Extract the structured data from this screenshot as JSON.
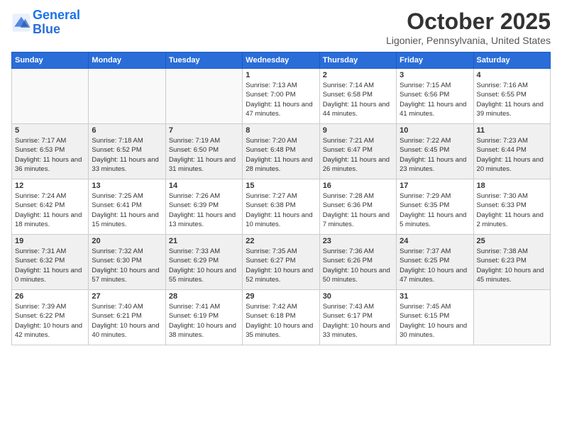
{
  "header": {
    "logo_line1": "General",
    "logo_line2": "Blue",
    "month": "October 2025",
    "location": "Ligonier, Pennsylvania, United States"
  },
  "days_of_week": [
    "Sunday",
    "Monday",
    "Tuesday",
    "Wednesday",
    "Thursday",
    "Friday",
    "Saturday"
  ],
  "weeks": [
    [
      {
        "day": "",
        "empty": true
      },
      {
        "day": "",
        "empty": true
      },
      {
        "day": "",
        "empty": true
      },
      {
        "day": "1",
        "sunrise": "7:13 AM",
        "sunset": "7:00 PM",
        "daylight": "11 hours and 47 minutes."
      },
      {
        "day": "2",
        "sunrise": "7:14 AM",
        "sunset": "6:58 PM",
        "daylight": "11 hours and 44 minutes."
      },
      {
        "day": "3",
        "sunrise": "7:15 AM",
        "sunset": "6:56 PM",
        "daylight": "11 hours and 41 minutes."
      },
      {
        "day": "4",
        "sunrise": "7:16 AM",
        "sunset": "6:55 PM",
        "daylight": "11 hours and 39 minutes."
      }
    ],
    [
      {
        "day": "5",
        "sunrise": "7:17 AM",
        "sunset": "6:53 PM",
        "daylight": "11 hours and 36 minutes."
      },
      {
        "day": "6",
        "sunrise": "7:18 AM",
        "sunset": "6:52 PM",
        "daylight": "11 hours and 33 minutes."
      },
      {
        "day": "7",
        "sunrise": "7:19 AM",
        "sunset": "6:50 PM",
        "daylight": "11 hours and 31 minutes."
      },
      {
        "day": "8",
        "sunrise": "7:20 AM",
        "sunset": "6:48 PM",
        "daylight": "11 hours and 28 minutes."
      },
      {
        "day": "9",
        "sunrise": "7:21 AM",
        "sunset": "6:47 PM",
        "daylight": "11 hours and 26 minutes."
      },
      {
        "day": "10",
        "sunrise": "7:22 AM",
        "sunset": "6:45 PM",
        "daylight": "11 hours and 23 minutes."
      },
      {
        "day": "11",
        "sunrise": "7:23 AM",
        "sunset": "6:44 PM",
        "daylight": "11 hours and 20 minutes."
      }
    ],
    [
      {
        "day": "12",
        "sunrise": "7:24 AM",
        "sunset": "6:42 PM",
        "daylight": "11 hours and 18 minutes."
      },
      {
        "day": "13",
        "sunrise": "7:25 AM",
        "sunset": "6:41 PM",
        "daylight": "11 hours and 15 minutes."
      },
      {
        "day": "14",
        "sunrise": "7:26 AM",
        "sunset": "6:39 PM",
        "daylight": "11 hours and 13 minutes."
      },
      {
        "day": "15",
        "sunrise": "7:27 AM",
        "sunset": "6:38 PM",
        "daylight": "11 hours and 10 minutes."
      },
      {
        "day": "16",
        "sunrise": "7:28 AM",
        "sunset": "6:36 PM",
        "daylight": "11 hours and 7 minutes."
      },
      {
        "day": "17",
        "sunrise": "7:29 AM",
        "sunset": "6:35 PM",
        "daylight": "11 hours and 5 minutes."
      },
      {
        "day": "18",
        "sunrise": "7:30 AM",
        "sunset": "6:33 PM",
        "daylight": "11 hours and 2 minutes."
      }
    ],
    [
      {
        "day": "19",
        "sunrise": "7:31 AM",
        "sunset": "6:32 PM",
        "daylight": "11 hours and 0 minutes."
      },
      {
        "day": "20",
        "sunrise": "7:32 AM",
        "sunset": "6:30 PM",
        "daylight": "10 hours and 57 minutes."
      },
      {
        "day": "21",
        "sunrise": "7:33 AM",
        "sunset": "6:29 PM",
        "daylight": "10 hours and 55 minutes."
      },
      {
        "day": "22",
        "sunrise": "7:35 AM",
        "sunset": "6:27 PM",
        "daylight": "10 hours and 52 minutes."
      },
      {
        "day": "23",
        "sunrise": "7:36 AM",
        "sunset": "6:26 PM",
        "daylight": "10 hours and 50 minutes."
      },
      {
        "day": "24",
        "sunrise": "7:37 AM",
        "sunset": "6:25 PM",
        "daylight": "10 hours and 47 minutes."
      },
      {
        "day": "25",
        "sunrise": "7:38 AM",
        "sunset": "6:23 PM",
        "daylight": "10 hours and 45 minutes."
      }
    ],
    [
      {
        "day": "26",
        "sunrise": "7:39 AM",
        "sunset": "6:22 PM",
        "daylight": "10 hours and 42 minutes."
      },
      {
        "day": "27",
        "sunrise": "7:40 AM",
        "sunset": "6:21 PM",
        "daylight": "10 hours and 40 minutes."
      },
      {
        "day": "28",
        "sunrise": "7:41 AM",
        "sunset": "6:19 PM",
        "daylight": "10 hours and 38 minutes."
      },
      {
        "day": "29",
        "sunrise": "7:42 AM",
        "sunset": "6:18 PM",
        "daylight": "10 hours and 35 minutes."
      },
      {
        "day": "30",
        "sunrise": "7:43 AM",
        "sunset": "6:17 PM",
        "daylight": "10 hours and 33 minutes."
      },
      {
        "day": "31",
        "sunrise": "7:45 AM",
        "sunset": "6:15 PM",
        "daylight": "10 hours and 30 minutes."
      },
      {
        "day": "",
        "empty": true
      }
    ]
  ]
}
